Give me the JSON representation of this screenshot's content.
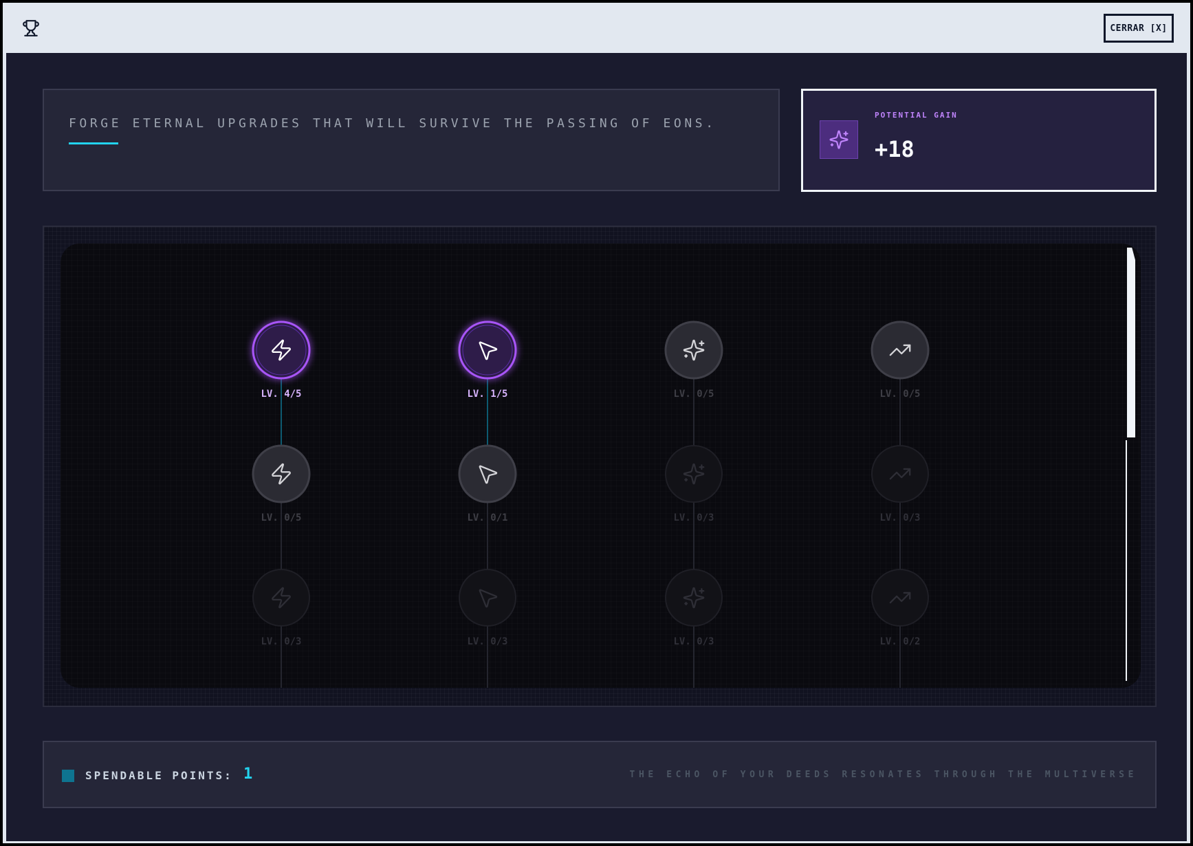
{
  "window": {
    "close_label": "CERRAR [X]",
    "title_icon": "trophy-icon"
  },
  "banner": {
    "text": "FORGE ETERNAL UPGRADES THAT WILL SURVIVE THE PASSING OF EONS."
  },
  "gain": {
    "label": "POTENTIAL GAIN",
    "value": "+18",
    "icon": "sparkles-icon"
  },
  "tree": {
    "columns": [
      {
        "icon": "zap-icon",
        "nodes": [
          {
            "level": "LV. 4/5",
            "state": "active"
          },
          {
            "level": "LV. 0/5",
            "state": "available"
          },
          {
            "level": "LV. 0/3",
            "state": "locked"
          }
        ]
      },
      {
        "icon": "cursor-icon",
        "nodes": [
          {
            "level": "LV. 1/5",
            "state": "active"
          },
          {
            "level": "LV. 0/1",
            "state": "available"
          },
          {
            "level": "LV. 0/3",
            "state": "locked"
          }
        ]
      },
      {
        "icon": "sparkles-icon",
        "nodes": [
          {
            "level": "LV. 0/5",
            "state": "available"
          },
          {
            "level": "LV. 0/3",
            "state": "locked"
          },
          {
            "level": "LV. 0/3",
            "state": "locked"
          }
        ]
      },
      {
        "icon": "trending-up-icon",
        "nodes": [
          {
            "level": "LV. 0/5",
            "state": "available"
          },
          {
            "level": "LV. 0/3",
            "state": "locked"
          },
          {
            "level": "LV. 0/2",
            "state": "locked"
          }
        ]
      }
    ],
    "colors": {
      "active_ring": "#a855f7",
      "active_fill": "#2e1f4a",
      "active_label": "#d8b4fe",
      "connector_active": "#0e7490",
      "connector_idle": "#2d2e38"
    }
  },
  "footer": {
    "points_label": "SPENDABLE POINTS:",
    "points_value": "1",
    "tagline": "THE ECHO OF YOUR DEEDS RESONATES THROUGH THE MULTIVERSE"
  }
}
